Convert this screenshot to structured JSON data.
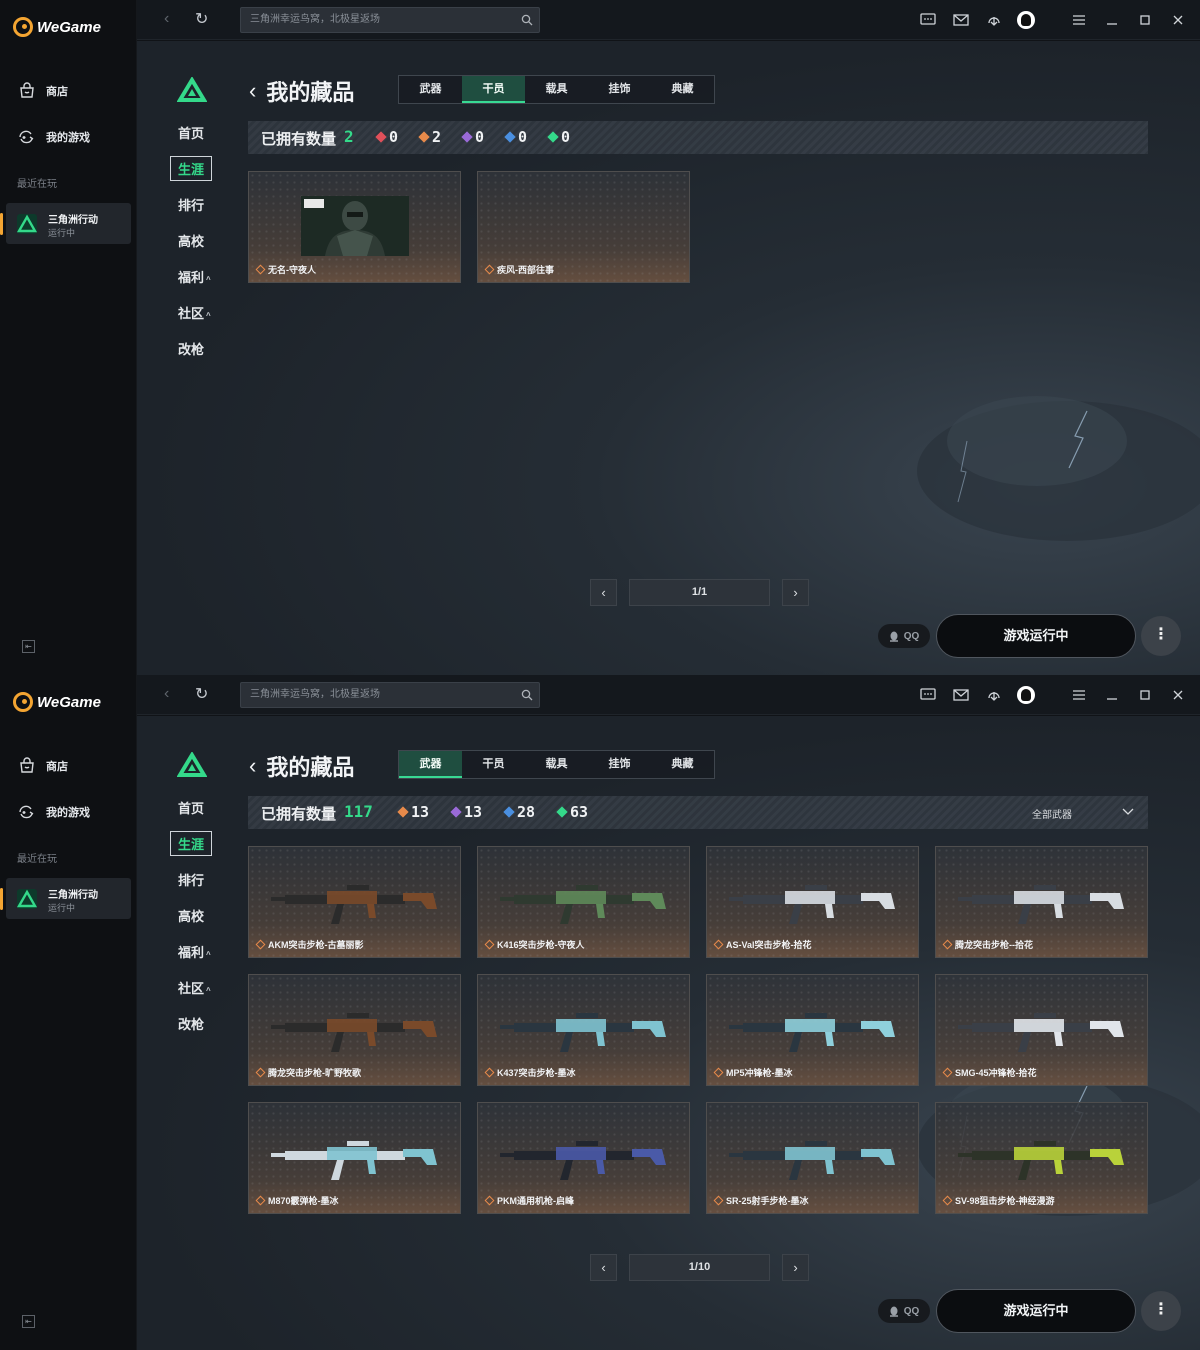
{
  "app": {
    "name": "WeGame"
  },
  "sidebar": {
    "items": [
      {
        "label": "商店"
      },
      {
        "label": "我的游戏"
      }
    ],
    "recent_label": "最近在玩",
    "recent_game": {
      "name": "三角洲行动",
      "status": "运行中"
    }
  },
  "topbar": {
    "search_placeholder": "三角洲幸运鸟窝，北极星返场"
  },
  "game_nav": {
    "items": [
      {
        "label": "首页",
        "caret": ""
      },
      {
        "label": "生涯",
        "caret": ""
      },
      {
        "label": "排行",
        "caret": ""
      },
      {
        "label": "高校",
        "caret": ""
      },
      {
        "label": "福利",
        "caret": "^"
      },
      {
        "label": "社区",
        "caret": "^"
      },
      {
        "label": "改枪",
        "caret": ""
      }
    ],
    "active": "生涯"
  },
  "page": {
    "title": "我的藏品"
  },
  "tabs": [
    "武器",
    "干员",
    "载具",
    "挂饰",
    "典藏"
  ],
  "colors": {
    "accent": "#34d98a",
    "rarity_red": "#e0505a",
    "rarity_orange": "#e88a4a",
    "rarity_purple": "#9a6ad8",
    "rarity_blue": "#4a8fe0",
    "rarity_green": "#34d98a"
  },
  "footer": {
    "qq_label": "QQ",
    "run_label": "游戏运行中",
    "more": "⋮"
  },
  "screens": [
    {
      "active_tab": "干员",
      "owned_label": "已拥有数量",
      "owned_count": "2",
      "rarity_counts": [
        {
          "rarity": "red",
          "value": "0"
        },
        {
          "rarity": "orange",
          "value": "2"
        },
        {
          "rarity": "purple",
          "value": "0"
        },
        {
          "rarity": "blue",
          "value": "0"
        },
        {
          "rarity": "green",
          "value": "0"
        }
      ],
      "items": [
        {
          "name": "无名-守夜人",
          "image": "operator-portrait"
        },
        {
          "name": "疾风-西部往事",
          "image": "empty"
        }
      ],
      "pagination": "1/1"
    },
    {
      "active_tab": "武器",
      "owned_label": "已拥有数量",
      "owned_count": "117",
      "filter_label": "全部武器",
      "rarity_counts": [
        {
          "rarity": "orange",
          "value": "13"
        },
        {
          "rarity": "purple",
          "value": "13"
        },
        {
          "rarity": "blue",
          "value": "28"
        },
        {
          "rarity": "green",
          "value": "63"
        }
      ],
      "items": [
        {
          "name": "AKM突击步枪-古墓丽影",
          "image": "rifle-brown"
        },
        {
          "name": "K416突击步枪-守夜人",
          "image": "rifle-green"
        },
        {
          "name": "AS-Val突击步枪-拾花",
          "image": "rifle-white"
        },
        {
          "name": "腾龙突击步枪--拾花",
          "image": "rifle-white"
        },
        {
          "name": "腾龙突击步枪-旷野牧歌",
          "image": "rifle-brown"
        },
        {
          "name": "K437突击步枪-墨冰",
          "image": "rifle-ice"
        },
        {
          "name": "MP5冲锋枪-墨冰",
          "image": "smg-ice"
        },
        {
          "name": "SMG-45冲锋枪-拾花",
          "image": "smg-white"
        },
        {
          "name": "M870霰弹枪-墨冰",
          "image": "shotgun-ice"
        },
        {
          "name": "PKM通用机枪-启峰",
          "image": "lmg-blue"
        },
        {
          "name": "SR-25射手步枪-墨冰",
          "image": "rifle-ice"
        },
        {
          "name": "SV-98狙击步枪-神经漫游",
          "image": "sniper-lime"
        }
      ],
      "pagination": "1/10"
    }
  ]
}
